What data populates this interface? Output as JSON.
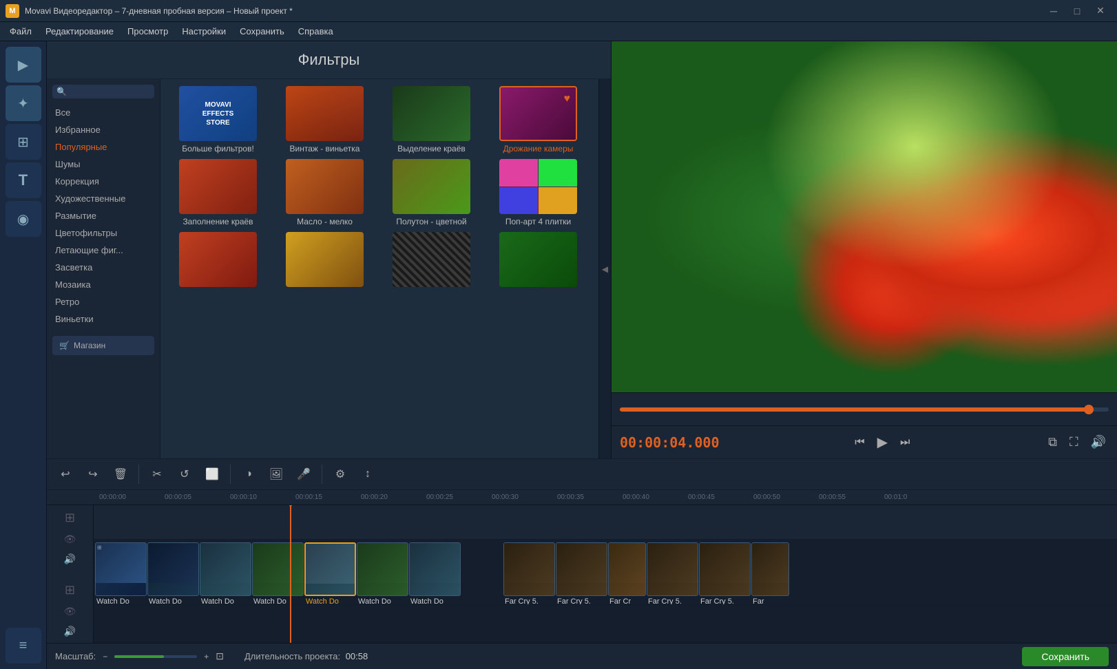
{
  "titlebar": {
    "title": "Movavi Видеоредактор – 7-дневная пробная версия – Новый проект *",
    "icon": "M"
  },
  "menubar": {
    "items": [
      "Файл",
      "Редактирование",
      "Просмотр",
      "Настройки",
      "Сохранить",
      "Справка"
    ]
  },
  "left_toolbar": {
    "tools": [
      {
        "name": "media",
        "icon": "▶",
        "label": ""
      },
      {
        "name": "effects",
        "icon": "✨",
        "label": ""
      },
      {
        "name": "transitions",
        "icon": "⊞",
        "label": ""
      },
      {
        "name": "text",
        "icon": "T",
        "label": ""
      },
      {
        "name": "camera",
        "icon": "📷",
        "label": ""
      },
      {
        "name": "menu",
        "icon": "≡",
        "label": ""
      }
    ]
  },
  "filters": {
    "title": "Фильтры",
    "search_placeholder": "Поиск",
    "categories": [
      {
        "id": "all",
        "label": "Все"
      },
      {
        "id": "favorites",
        "label": "Избранное"
      },
      {
        "id": "popular",
        "label": "Популярные",
        "active": true
      },
      {
        "id": "noise",
        "label": "Шумы"
      },
      {
        "id": "correction",
        "label": "Коррекция"
      },
      {
        "id": "artistic",
        "label": "Художественные"
      },
      {
        "id": "blur",
        "label": "Размытие"
      },
      {
        "id": "color",
        "label": "Цветофильтры"
      },
      {
        "id": "flying",
        "label": "Летающие фиг..."
      },
      {
        "id": "flash",
        "label": "Засветка"
      },
      {
        "id": "mosaic",
        "label": "Мозаика"
      },
      {
        "id": "retro",
        "label": "Ретро"
      },
      {
        "id": "vignette",
        "label": "Виньетки"
      }
    ],
    "store_label": "Магазин",
    "items": [
      {
        "id": "store",
        "label": "Больше фильтров!",
        "type": "store"
      },
      {
        "id": "vintage",
        "label": "Винтаж - виньетка",
        "type": "vintage"
      },
      {
        "id": "edge",
        "label": "Выделение краёв",
        "type": "edge"
      },
      {
        "id": "shake",
        "label": "Дрожание камеры",
        "type": "shake",
        "active": true
      },
      {
        "id": "fill",
        "label": "Заполнение краёв",
        "type": "fill"
      },
      {
        "id": "oil",
        "label": "Масло - мелко",
        "type": "oil"
      },
      {
        "id": "halftone",
        "label": "Полутон - цветной",
        "type": "halftone"
      },
      {
        "id": "popart",
        "label": "Поп-арт 4 плитки",
        "type": "popart"
      },
      {
        "id": "row3a",
        "label": "",
        "type": "row3a"
      },
      {
        "id": "row3b",
        "label": "",
        "type": "row3b"
      },
      {
        "id": "row3c",
        "label": "",
        "type": "row3c"
      },
      {
        "id": "row3d",
        "label": "",
        "type": "row3d"
      }
    ]
  },
  "playback": {
    "time": "00:00:04.000",
    "progress_pct": 96,
    "btn_prev": "⏮",
    "btn_play": "▶",
    "btn_next": "⏭",
    "btn_export": "⬡",
    "btn_fullscreen": "⛶",
    "btn_volume": "🔊"
  },
  "toolbar": {
    "buttons": [
      "↩",
      "↪",
      "🗑",
      "✂",
      "↺",
      "⬜",
      "◑",
      "🖼",
      "🎤",
      "⚙",
      "↕"
    ]
  },
  "timeline": {
    "ruler_marks": [
      "00:00:00",
      "00:00:05",
      "00:00:10",
      "00:00:15",
      "00:00:20",
      "00:00:25",
      "00:00:30",
      "00:00:35",
      "00:00:40",
      "00:00:45",
      "00:00:50",
      "00:00:55",
      "00:01:0"
    ],
    "playhead_pos": "00:00:15",
    "clips_watch": [
      "Watch Do",
      "Watch Do",
      "Watch Do",
      "Watch Do",
      "Watch Do",
      "Watch Do",
      "Watch Do"
    ],
    "clips_farcry": [
      "Far Cry 5.",
      "Far Cry 5.",
      "Far Cr",
      "Far Cry 5.",
      "Far Cry 5.",
      "Far"
    ]
  },
  "bottom_bar": {
    "scale_label": "Масштаб:",
    "duration_label": "Длительность проекта:",
    "duration_value": "00:58",
    "save_label": "Сохранить"
  }
}
